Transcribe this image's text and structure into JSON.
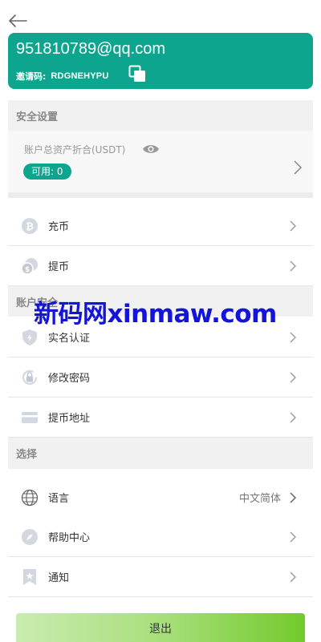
{
  "account": {
    "email": "951810789@qq.com",
    "invite_label": "邀请码:",
    "invite_code": "RDGNEHYPU"
  },
  "security_section": {
    "title": "安全设置"
  },
  "assets": {
    "label": "账户总资产折合(USDT)",
    "available": "可用: 0"
  },
  "wallet_items": [
    {
      "label": "充币",
      "icon": "bitcoin-icon"
    },
    {
      "label": "提币",
      "icon": "coins-icon"
    }
  ],
  "account_section": {
    "title": "账户安全"
  },
  "account_items": [
    {
      "label": "实名认证",
      "icon": "shield-icon"
    },
    {
      "label": "修改密码",
      "icon": "lock-refresh-icon"
    },
    {
      "label": "提币地址",
      "icon": "card-icon"
    }
  ],
  "select_section": {
    "title": "选择"
  },
  "select_items": [
    {
      "label": "语言",
      "value": "中文简体",
      "icon": "globe-icon"
    },
    {
      "label": "帮助中心",
      "icon": "compass-icon"
    },
    {
      "label": "通知",
      "icon": "bookmark-star-icon"
    }
  ],
  "watermark": "新码网xinmaw.com",
  "logout_label": "退出",
  "colors": {
    "accent": "#0ea58f",
    "watermark": "#1414d8"
  }
}
